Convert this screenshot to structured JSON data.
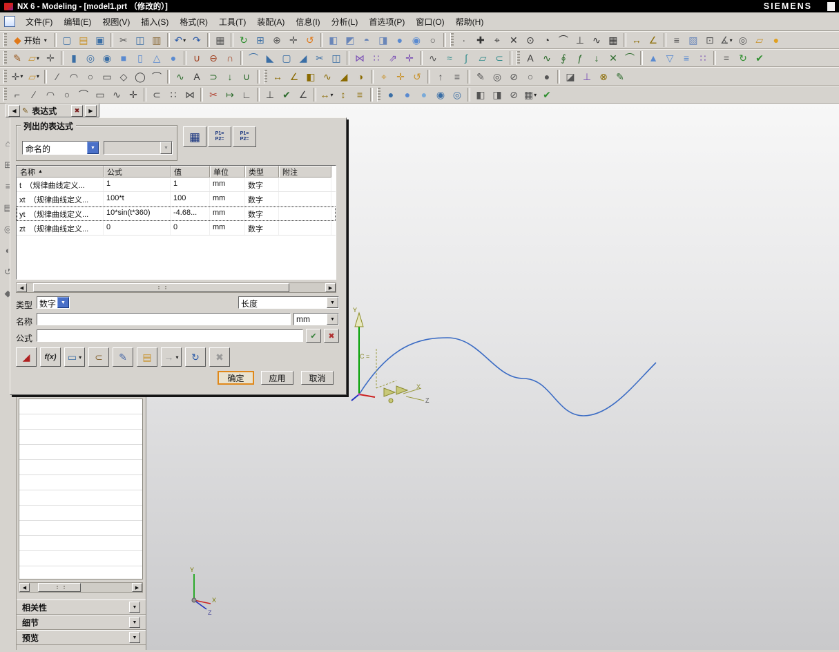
{
  "titlebar": {
    "title": "NX 6 - Modeling - [model1.prt （修改的）]",
    "brand": "SIEMENS"
  },
  "menubar": {
    "items": [
      "文件(F)",
      "编辑(E)",
      "视图(V)",
      "插入(S)",
      "格式(R)",
      "工具(T)",
      "装配(A)",
      "信息(I)",
      "分析(L)",
      "首选项(P)",
      "窗口(O)",
      "帮助(H)"
    ]
  },
  "icons": {
    "left": "◀",
    "right": "▶",
    "up": "▲",
    "down": "▼",
    "down_small": "▾",
    "cross": "✖",
    "check": "✔",
    "grid": "▦",
    "sort_asc": "▲"
  },
  "tabstrip": {
    "title": "表达式",
    "dialog_icon": "✎"
  },
  "toolbars": {
    "row1": [
      {
        "grip": 1
      },
      {
        "n": "start-menu-button",
        "g": "◆",
        "c": "#e07818",
        "label": "开始",
        "dd": 1
      },
      {
        "sep": 1
      },
      {
        "n": "new-part-button",
        "g": "▢",
        "c": "#3a6ea5"
      },
      {
        "n": "open-button",
        "g": "▤",
        "c": "#c8922a"
      },
      {
        "n": "save-button",
        "g": "▣",
        "c": "#3a6ea5"
      },
      {
        "sep": 1
      },
      {
        "n": "cut-button",
        "g": "✂",
        "c": "#555555"
      },
      {
        "n": "copy-button",
        "g": "◫",
        "c": "#3a6ea5"
      },
      {
        "n": "paste-button",
        "g": "▥",
        "c": "#8a6a3a"
      },
      {
        "sep": 1
      },
      {
        "n": "undo-button",
        "g": "↶",
        "c": "#2a5aa8",
        "dd": 1
      },
      {
        "n": "redo-button",
        "g": "↷",
        "c": "#2a5aa8"
      },
      {
        "sep": 1
      },
      {
        "n": "print-button",
        "g": "▦",
        "c": "#555555"
      },
      {
        "sep": 1
      },
      {
        "n": "refresh-view-button",
        "g": "↻",
        "c": "#2f8f2f"
      },
      {
        "n": "fit-view-button",
        "g": "⊞",
        "c": "#3a6ea5"
      },
      {
        "n": "zoom-view-button",
        "g": "⊕",
        "c": "#555555"
      },
      {
        "n": "pan-view-button",
        "g": "✛",
        "c": "#555555"
      },
      {
        "n": "rotate-view-button",
        "g": "↺",
        "c": "#e07818"
      },
      {
        "sep": 1
      },
      {
        "n": "trimetric-view-button",
        "g": "◧",
        "c": "#6a86b8"
      },
      {
        "n": "isometric-view-button",
        "g": "◩",
        "c": "#6a86b8"
      },
      {
        "n": "top-view-button",
        "g": "◓",
        "c": "#6a86b8"
      },
      {
        "n": "front-view-button",
        "g": "◨",
        "c": "#6a86b8"
      },
      {
        "n": "shaded-view-button",
        "g": "●",
        "c": "#5a8ad0"
      },
      {
        "n": "shaded-edges-view-button",
        "g": "◉",
        "c": "#5a8ad0"
      },
      {
        "n": "wireframe-view-button",
        "g": "○",
        "c": "#555555"
      },
      {
        "sep": 1
      },
      {
        "grip": 1
      },
      {
        "n": "snap-point-toggle",
        "g": "∙",
        "c": "#333333"
      },
      {
        "n": "snap-endpoint-toggle",
        "g": "✚",
        "c": "#333333"
      },
      {
        "n": "snap-midpoint-toggle",
        "g": "⌖",
        "c": "#333333"
      },
      {
        "n": "snap-intersection-toggle",
        "g": "✕",
        "c": "#333333"
      },
      {
        "n": "snap-center-toggle",
        "g": "⊙",
        "c": "#333333"
      },
      {
        "n": "snap-quadrant-toggle",
        "g": "◔",
        "c": "#333333"
      },
      {
        "n": "snap-tangent-toggle",
        "g": "⌒",
        "c": "#333333"
      },
      {
        "n": "snap-perpendicular-toggle",
        "g": "⊥",
        "c": "#333333"
      },
      {
        "n": "snap-on-curve-toggle",
        "g": "∿",
        "c": "#333333"
      },
      {
        "n": "snap-grid-toggle",
        "g": "▦",
        "c": "#333333"
      },
      {
        "sep": 1
      },
      {
        "n": "measure-distance-button",
        "g": "↔",
        "c": "#8a6a00"
      },
      {
        "n": "measure-angle-button",
        "g": "∠",
        "c": "#8a6a00"
      },
      {
        "sep": 1
      },
      {
        "n": "layer-settings-button",
        "g": "≡",
        "c": "#555555"
      },
      {
        "n": "display-mode-button",
        "g": "▧",
        "c": "#6a86b8"
      },
      {
        "n": "full-screen-button",
        "g": "⊡",
        "c": "#555555"
      },
      {
        "n": "orient-view-button",
        "g": "∡",
        "c": "#555555",
        "dd": 1
      },
      {
        "n": "show-hide-button",
        "g": "◎",
        "c": "#555555"
      },
      {
        "n": "datum-display-toggle",
        "g": "▱",
        "c": "#c8922a"
      },
      {
        "n": "highlight-button",
        "g": "●",
        "c": "#e0a020"
      }
    ],
    "row2": [
      {
        "grip": 1
      },
      {
        "n": "sketch-button",
        "g": "✎",
        "c": "#9a5a20"
      },
      {
        "n": "datum-plane-button",
        "g": "▱",
        "c": "#c8922a",
        "dd": 1
      },
      {
        "n": "point-button",
        "g": "✛",
        "c": "#555555"
      },
      {
        "sep": 1
      },
      {
        "n": "extrude-button",
        "g": "▮",
        "c": "#3a6ea5"
      },
      {
        "n": "revolve-button",
        "g": "◎",
        "c": "#3a6ea5"
      },
      {
        "n": "hole-button",
        "g": "◉",
        "c": "#3a6ea5"
      },
      {
        "n": "block-button",
        "g": "■",
        "c": "#5a8ad0"
      },
      {
        "n": "cylinder-button",
        "g": "▯",
        "c": "#5a8ad0"
      },
      {
        "n": "cone-button",
        "g": "△",
        "c": "#5a8ad0"
      },
      {
        "n": "sphere-button",
        "g": "●",
        "c": "#5a8ad0"
      },
      {
        "sep": 1
      },
      {
        "n": "unite-button",
        "g": "∪",
        "c": "#a04020"
      },
      {
        "n": "subtract-button",
        "g": "⊖",
        "c": "#a04020"
      },
      {
        "n": "intersect-button",
        "g": "∩",
        "c": "#a04020"
      },
      {
        "sep": 1
      },
      {
        "n": "edge-blend-button",
        "g": "⌒",
        "c": "#3a6ea5"
      },
      {
        "n": "chamfer-button",
        "g": "◣",
        "c": "#3a6ea5"
      },
      {
        "n": "shell-button",
        "g": "▢",
        "c": "#3a6ea5"
      },
      {
        "n": "draft-button",
        "g": "◢",
        "c": "#3a6ea5"
      },
      {
        "n": "trim-body-button",
        "g": "✂",
        "c": "#3a6ea5"
      },
      {
        "n": "split-body-button",
        "g": "◫",
        "c": "#3a6ea5"
      },
      {
        "sep": 1
      },
      {
        "n": "mirror-feature-button",
        "g": "⋈",
        "c": "#7a4fb5"
      },
      {
        "n": "pattern-feature-button",
        "g": "∷",
        "c": "#7a4fb5"
      },
      {
        "n": "scale-body-button",
        "g": "⇗",
        "c": "#7a4fb5"
      },
      {
        "n": "move-object-button",
        "g": "✛",
        "c": "#7a4fb5"
      },
      {
        "sep": 1
      },
      {
        "n": "thread-button",
        "g": "∿",
        "c": "#555555"
      },
      {
        "n": "swept-button",
        "g": "≈",
        "c": "#2e8b8b"
      },
      {
        "n": "through-curves-button",
        "g": "∫",
        "c": "#2e8b8b"
      },
      {
        "n": "ruled-surface-button",
        "g": "▱",
        "c": "#2e8b8b"
      },
      {
        "n": "offset-surface-button",
        "g": "⊂",
        "c": "#2e8b8b"
      },
      {
        "sep": 1
      },
      {
        "grip": 1
      },
      {
        "n": "text-button",
        "g": "A",
        "c": "#333333"
      },
      {
        "n": "spline-button",
        "g": "∿",
        "c": "#2a6a2a"
      },
      {
        "n": "helix-button",
        "g": "∮",
        "c": "#2a6a2a"
      },
      {
        "n": "law-curve-button",
        "g": "ƒ",
        "c": "#2a6a2a"
      },
      {
        "n": "project-curve-button",
        "g": "↓",
        "c": "#2a6a2a"
      },
      {
        "n": "intersection-curve-button",
        "g": "✕",
        "c": "#2a6a2a"
      },
      {
        "n": "bridge-curve-button",
        "g": "⌒",
        "c": "#2a6a2a"
      },
      {
        "sep": 1
      },
      {
        "n": "boss-button",
        "g": "▲",
        "c": "#5a8ad0"
      },
      {
        "n": "pocket-button",
        "g": "▽",
        "c": "#5a8ad0"
      },
      {
        "n": "rib-button",
        "g": "≡",
        "c": "#5a8ad0"
      },
      {
        "n": "instance-geometry-button",
        "g": "∷",
        "c": "#7a4fb5"
      },
      {
        "sep": 1
      },
      {
        "n": "expressions-button",
        "g": "=",
        "c": "#333333"
      },
      {
        "n": "update-model-button",
        "g": "↻",
        "c": "#2f8f2f"
      },
      {
        "n": "part-cleanup-button",
        "g": "✔",
        "c": "#2f8f2f"
      }
    ],
    "row3": [
      {
        "grip": 1
      },
      {
        "n": "point-dialog-button",
        "g": "✛",
        "c": "#555555",
        "dd": 1
      },
      {
        "n": "plane-dialog-button",
        "g": "▱",
        "c": "#c8922a",
        "dd": 1
      },
      {
        "sep": 1
      },
      {
        "n": "line-curve-button",
        "g": "∕",
        "c": "#444444"
      },
      {
        "n": "arc-curve-button",
        "g": "◠",
        "c": "#444444"
      },
      {
        "n": "circle-curve-button",
        "g": "○",
        "c": "#444444"
      },
      {
        "n": "rectangle-curve-button",
        "g": "▭",
        "c": "#444444"
      },
      {
        "n": "polygon-curve-button",
        "g": "◇",
        "c": "#444444"
      },
      {
        "n": "ellipse-curve-button",
        "g": "◯",
        "c": "#444444"
      },
      {
        "n": "conic-curve-button",
        "g": "⌒",
        "c": "#444444"
      },
      {
        "sep": 1
      },
      {
        "n": "studio-spline-button",
        "g": "∿",
        "c": "#2a6a2a"
      },
      {
        "n": "text-curve-button",
        "g": "A",
        "c": "#333333"
      },
      {
        "n": "offset-curve-button",
        "g": "⊃",
        "c": "#2a6a2a"
      },
      {
        "n": "project-button",
        "g": "↓",
        "c": "#2a6a2a"
      },
      {
        "n": "combine-curve-button",
        "g": "∪",
        "c": "#2a6a2a"
      },
      {
        "sep": 1
      },
      {
        "grip": 1
      },
      {
        "n": "analysis-distance-button",
        "g": "↔",
        "c": "#8a6a00"
      },
      {
        "n": "analysis-angle-button",
        "g": "∠",
        "c": "#8a6a00"
      },
      {
        "n": "section-analysis-button",
        "g": "◧",
        "c": "#8a6a00"
      },
      {
        "n": "curve-analysis-button",
        "g": "∿",
        "c": "#8a6a00"
      },
      {
        "n": "draft-analysis-button",
        "g": "◢",
        "c": "#8a6a00"
      },
      {
        "n": "reflection-analysis-button",
        "g": "◑",
        "c": "#8a6a00"
      },
      {
        "sep": 1
      },
      {
        "n": "wcs-dynamics-button",
        "g": "⌖",
        "c": "#c8922a"
      },
      {
        "n": "wcs-origin-button",
        "g": "✛",
        "c": "#c8922a"
      },
      {
        "n": "wcs-rotate-button",
        "g": "↺",
        "c": "#c8922a"
      },
      {
        "sep": 1
      },
      {
        "n": "move-to-layer-button",
        "g": "↑",
        "c": "#555555"
      },
      {
        "n": "layer-visible-in-view-button",
        "g": "≡",
        "c": "#555555"
      },
      {
        "sep": 1
      },
      {
        "n": "edit-object-display-button",
        "g": "✎",
        "c": "#555555"
      },
      {
        "n": "show-and-hide-button",
        "g": "◎",
        "c": "#555555"
      },
      {
        "n": "immediate-hide-button",
        "g": "⊘",
        "c": "#555555"
      },
      {
        "n": "hide-button",
        "g": "○",
        "c": "#555555"
      },
      {
        "n": "show-button",
        "g": "●",
        "c": "#555555"
      },
      {
        "sep": 1
      },
      {
        "n": "view-section-button",
        "g": "◪",
        "c": "#555555"
      },
      {
        "n": "assembly-constraints-button",
        "g": "⊥",
        "c": "#7a4fb5"
      },
      {
        "n": "interference-check-button",
        "g": "⊗",
        "c": "#8a6a00"
      },
      {
        "n": "task-environment-sketch-button",
        "g": "✎",
        "c": "#2a6a2a"
      }
    ],
    "row4": [
      {
        "grip": 1
      },
      {
        "n": "profile-button",
        "g": "⌐",
        "c": "#444444"
      },
      {
        "n": "sketch-line-button",
        "g": "∕",
        "c": "#444444"
      },
      {
        "n": "sketch-arc-button",
        "g": "◠",
        "c": "#444444"
      },
      {
        "n": "sketch-circle-button",
        "g": "○",
        "c": "#444444"
      },
      {
        "n": "sketch-fillet-button",
        "g": "⌒",
        "c": "#444444"
      },
      {
        "n": "sketch-rectangle-button",
        "g": "▭",
        "c": "#444444"
      },
      {
        "n": "sketch-spline-button",
        "g": "∿",
        "c": "#444444"
      },
      {
        "n": "sketch-point-button",
        "g": "✛",
        "c": "#444444"
      },
      {
        "sep": 1
      },
      {
        "n": "offset-sketch-curve-button",
        "g": "⊂",
        "c": "#444444"
      },
      {
        "n": "pattern-sketch-curve-button",
        "g": "∷",
        "c": "#444444"
      },
      {
        "n": "mirror-sketch-curve-button",
        "g": "⋈",
        "c": "#444444"
      },
      {
        "sep": 1
      },
      {
        "n": "quick-trim-button",
        "g": "✂",
        "c": "#b04030"
      },
      {
        "n": "quick-extend-button",
        "g": "↦",
        "c": "#2a6a2a"
      },
      {
        "n": "make-corner-button",
        "g": "∟",
        "c": "#444444"
      },
      {
        "sep": 1
      },
      {
        "n": "constraints-button",
        "g": "⊥",
        "c": "#444444"
      },
      {
        "n": "auto-constrain-button",
        "g": "✔",
        "c": "#2a6a2a"
      },
      {
        "n": "show-constraints-button",
        "g": "∠",
        "c": "#444444"
      },
      {
        "sep": 1
      },
      {
        "n": "inferred-dimension-button",
        "g": "↔",
        "c": "#8a6a00",
        "dd": 1
      },
      {
        "n": "auto-dimension-button",
        "g": "↕",
        "c": "#8a6a00"
      },
      {
        "n": "continuous-auto-dimension-button",
        "g": "≡",
        "c": "#8a6a00"
      },
      {
        "sep": 1
      },
      {
        "grip": 1
      },
      {
        "n": "move-face-button",
        "g": "●",
        "c": "#3a6ea5"
      },
      {
        "n": "pull-face-button",
        "g": "●",
        "c": "#5a8ad0"
      },
      {
        "n": "offset-region-button",
        "g": "●",
        "c": "#7aaad8"
      },
      {
        "n": "replace-face-button",
        "g": "◉",
        "c": "#3a6ea5"
      },
      {
        "n": "resize-blend-button",
        "g": "◎",
        "c": "#3a6ea5"
      },
      {
        "sep": 1
      },
      {
        "n": "edit-section-button",
        "g": "◧",
        "c": "#555555"
      },
      {
        "n": "clip-section-button",
        "g": "◨",
        "c": "#555555"
      },
      {
        "n": "convert-to-reference-button",
        "g": "⊘",
        "c": "#555555"
      },
      {
        "n": "new-section-button",
        "g": "▦",
        "c": "#555555",
        "dd": 1
      },
      {
        "n": "finish-sketch-button",
        "g": "✔",
        "c": "#2f8f2f"
      }
    ]
  },
  "resource_bar": {
    "items": [
      {
        "n": "assembly-navigator-tab",
        "g": "⌂",
        "c": "#6a6a6a"
      },
      {
        "n": "constraint-navigator-tab",
        "g": "⊞",
        "c": "#6a6a6a"
      },
      {
        "n": "part-navigator-tab",
        "g": "≡",
        "c": "#6a6a6a"
      },
      {
        "n": "reuse-library-tab",
        "g": "▤",
        "c": "#6a6a6a"
      },
      {
        "n": "hd3d-tools-tab",
        "g": "◎",
        "c": "#6a6a6a"
      },
      {
        "n": "internet-explorer-tab",
        "g": "◐",
        "c": "#6a6a6a"
      },
      {
        "n": "history-tab",
        "g": "↺",
        "c": "#6a6a6a"
      },
      {
        "n": "system-materials-tab",
        "g": "◆",
        "c": "#6a6a6a"
      }
    ]
  },
  "dialog": {
    "listed_group_label": "列出的表达式",
    "filter_value": "命名的",
    "secondary_filter_value": "",
    "spreadsheet": {
      "p1": "P1=",
      "p2": "P2="
    },
    "table": {
      "headers": [
        "名称",
        "公式",
        "值",
        "单位",
        "类型",
        "附注"
      ],
      "rows": [
        {
          "name": "t　（规律曲线定义...",
          "formula": "1",
          "value": "1",
          "unit": "mm",
          "type": "数字",
          "note": ""
        },
        {
          "name": "xt　（规律曲线定义...",
          "formula": "100*t",
          "value": "100",
          "unit": "mm",
          "type": "数字",
          "note": ""
        },
        {
          "name": "yt　（规律曲线定义...",
          "formula": "10*sin(t*360)",
          "value": "-4.68...",
          "unit": "mm",
          "type": "数字",
          "note": ""
        },
        {
          "name": "zt　（规律曲线定义...",
          "formula": "0",
          "value": "0",
          "unit": "mm",
          "type": "数字",
          "note": ""
        }
      ]
    },
    "type_label": "类型",
    "type_value": "数字",
    "length_value": "长度",
    "name_label": "名称",
    "name_input": "",
    "unit_value": "mm",
    "formula_label": "公式",
    "formula_input": "",
    "tool_buttons": [
      {
        "n": "measure-distance-expression-button",
        "g": "◢",
        "c": "#b02020"
      },
      {
        "n": "function-editor-button",
        "g": "f(x)",
        "c": "#222222",
        "txt": 1
      },
      {
        "n": "measurement-tools-button",
        "g": "▭",
        "c": "#3a6ea5",
        "dd": 1
      },
      {
        "n": "create-interpart-reference-button",
        "g": "⊂",
        "c": "#8a6a3a"
      },
      {
        "n": "edit-interpart-reference-button",
        "g": "✎",
        "c": "#4a6aa8"
      },
      {
        "n": "open-referenced-part-button",
        "g": "▤",
        "c": "#c8922a"
      },
      {
        "n": "import-expressions-button",
        "g": "→",
        "c": "#9a9a9a",
        "dd": 1,
        "dis": 1
      },
      {
        "n": "refresh-values-button",
        "g": "↻",
        "c": "#2a5aa8"
      },
      {
        "n": "delete-expression-button",
        "g": "✖",
        "c": "#9a9a9a",
        "dis": 1
      }
    ],
    "ok": "确定",
    "apply": "应用",
    "cancel": "取消"
  },
  "navigator": {
    "empty_row_count": 13,
    "sections": [
      {
        "key": "dependencies",
        "label": "相关性"
      },
      {
        "key": "details",
        "label": "细节"
      },
      {
        "key": "preview",
        "label": "预览"
      }
    ]
  },
  "viewport": {
    "labels": {
      "x": "X",
      "y": "Y",
      "z": "Z",
      "c": "C ="
    },
    "triad": {
      "x": "X",
      "y": "Y",
      "z": "Z"
    },
    "curve_color": "#3a6bc4"
  }
}
